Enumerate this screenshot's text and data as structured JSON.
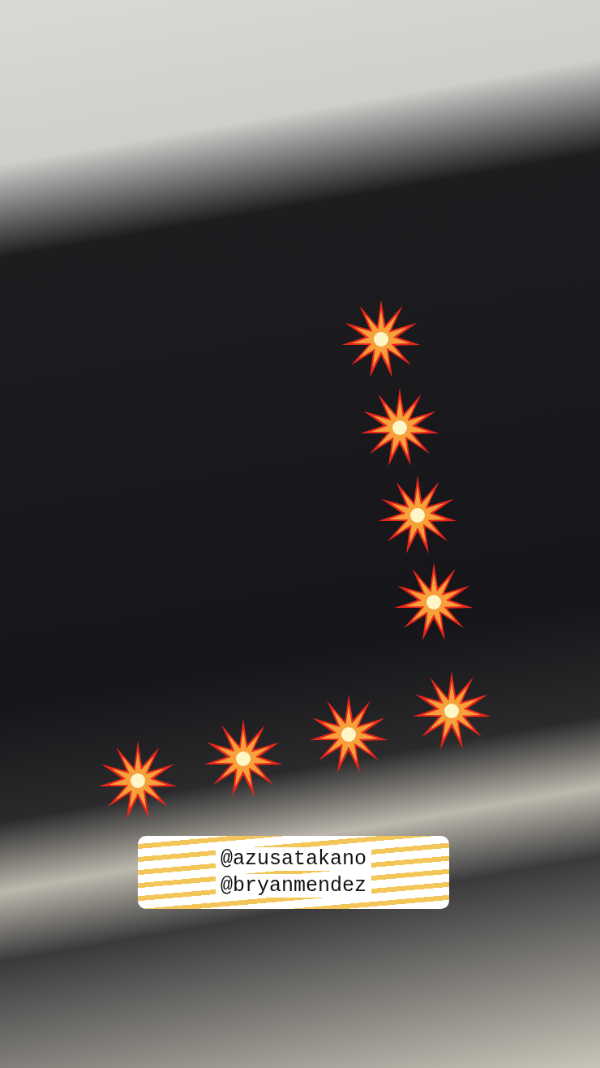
{
  "mentions": [
    "@azusatakano",
    "@bryanmendez"
  ]
}
